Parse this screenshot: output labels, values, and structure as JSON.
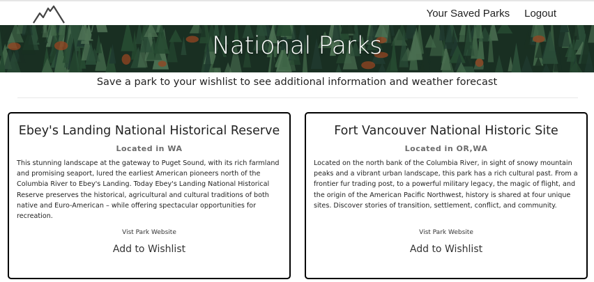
{
  "nav": {
    "logo_icon": "mountain-logo-icon",
    "links": [
      "Your Saved Parks",
      "Logout"
    ]
  },
  "banner": {
    "title": "National Parks"
  },
  "subtitle": "Save a park to your wishlist to see additional information and weather forecast",
  "parks": [
    {
      "name": "Ebey's Landing National Historical Reserve",
      "location": "Located in WA",
      "description": "This stunning landscape at the gateway to Puget Sound, with its rich farmland and promising seaport, lured the earliest American pioneers north of the Columbia River to Ebey's Landing. Today Ebey's Landing National Historical Reserve preserves the historical, agricultural and cultural traditions of both native and Euro-American – while offering spectacular opportunities for recreation.",
      "website_label": "Vist Park Website",
      "wishlist_label": "Add to Wishlist"
    },
    {
      "name": "Fort Vancouver National Historic Site",
      "location": "Located in OR,WA",
      "description": "Located on the north bank of the Columbia River, in sight of snowy mountain peaks and a vibrant urban landscape, this park has a rich cultural past. From a frontier fur trading post, to a powerful military legacy, the magic of flight, and the origin of the American Pacific Northwest, history is shared at four unique sites. Discover stories of transition, settlement, conflict, and community.",
      "website_label": "Vist Park Website",
      "wishlist_label": "Add to Wishlist"
    }
  ],
  "colors": {
    "forest_dark": "#1f3a2a",
    "forest_mid": "#2f5a3c",
    "forest_light": "#4f7d58",
    "autumn": "#b8562a",
    "card_border": "#000000"
  }
}
